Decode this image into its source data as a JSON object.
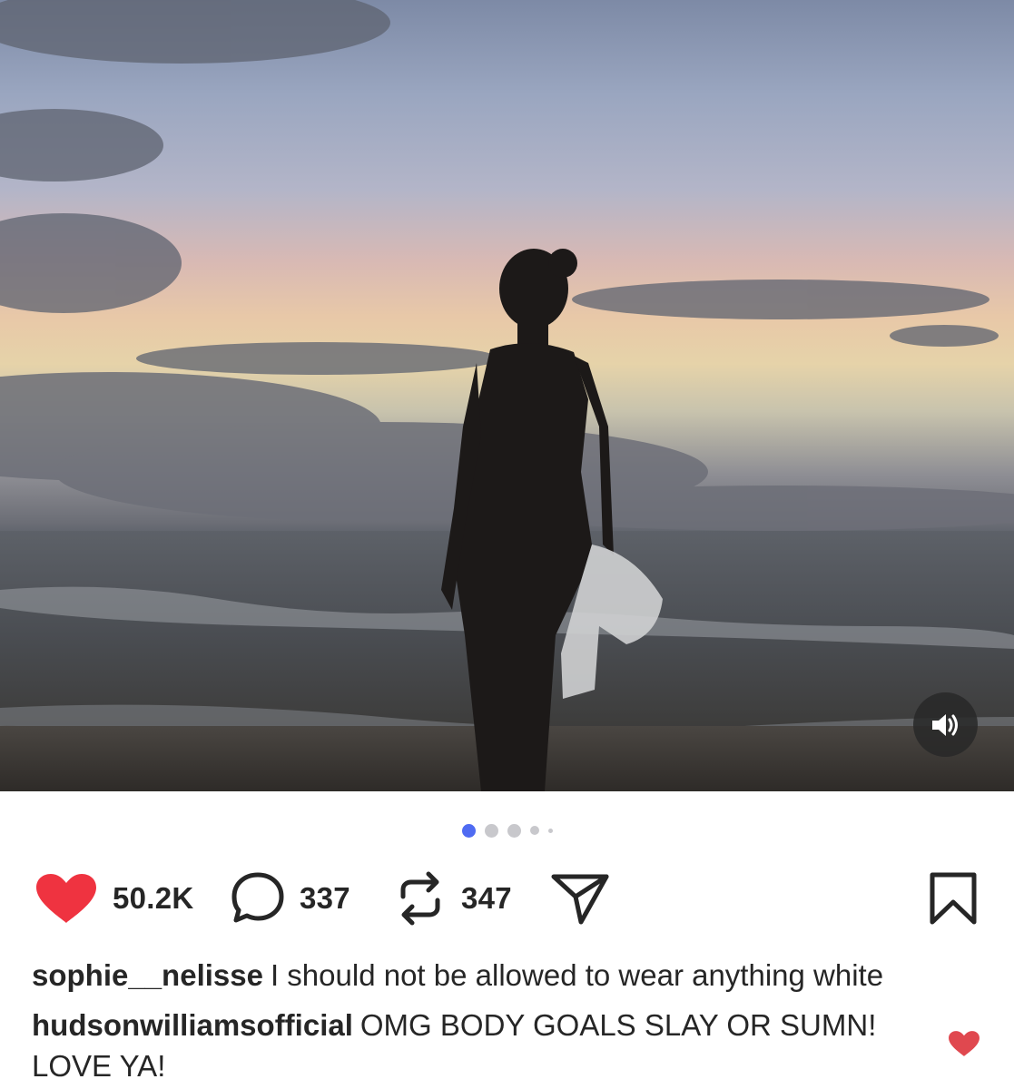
{
  "post": {
    "carousel": {
      "count": 5,
      "active_index": 0
    },
    "actions": {
      "like_count": "50.2K",
      "comment_count": "337",
      "repost_count": "347",
      "liked": true
    },
    "caption": {
      "username": "sophie__nelisse",
      "text": "I should not be allowed to wear anything white"
    },
    "comment": {
      "username": "hudsonwilliamsofficial",
      "text": "OMG BODY GOALS SLAY OR SUMN! LOVE YA!"
    }
  },
  "icons": {
    "sound": "speaker-icon",
    "like": "heart-icon",
    "comment": "comment-icon",
    "repost": "repost-icon",
    "share": "send-icon",
    "save": "bookmark-icon",
    "comment_like": "heart-icon"
  },
  "colors": {
    "like_red": "#ef3340",
    "dot_active": "#4f6bf2",
    "dot_inactive": "#c8c8cc",
    "text": "#262626"
  }
}
